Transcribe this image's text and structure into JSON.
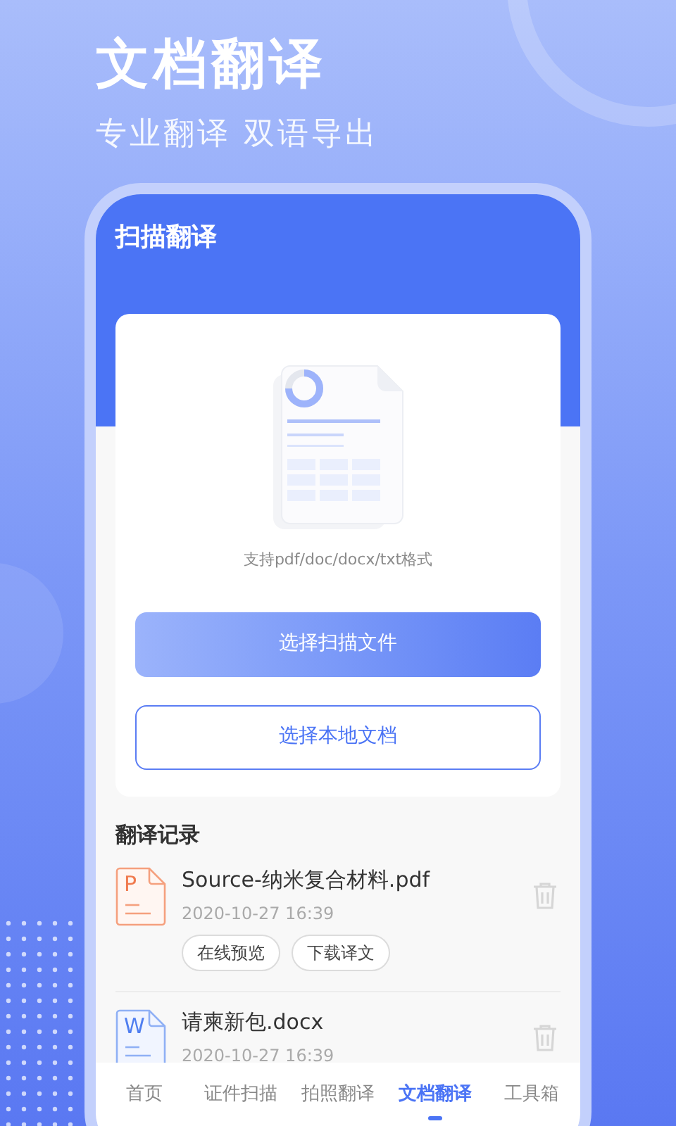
{
  "headline": "文档翻译",
  "subtitle": "专业翻译 双语导出",
  "screen": {
    "title": "扫描翻译",
    "upload_card": {
      "caption": "支持pdf/doc/docx/txt格式",
      "buttons": [
        {
          "label": "选择扫描文件",
          "kind": "primary"
        },
        {
          "label": "选择本地文档",
          "kind": "outline"
        }
      ]
    },
    "history": {
      "title": "翻译记录",
      "items": [
        {
          "kind": "pdf",
          "badge_letter": "P",
          "name": "Source-纳米复合材料.pdf",
          "time": "2020-10-27 16:39",
          "actions": [
            "在线预览",
            "下载译文"
          ]
        },
        {
          "kind": "word",
          "badge_letter": "W",
          "name": "请柬新包.docx",
          "time": "2020-10-27 16:39"
        }
      ]
    },
    "tabs": [
      {
        "label": "首页",
        "selected": false
      },
      {
        "label": "证件扫描",
        "selected": false
      },
      {
        "label": "拍照翻译",
        "selected": false
      },
      {
        "label": "文档翻译",
        "selected": true
      },
      {
        "label": "工具箱",
        "selected": false
      }
    ]
  }
}
